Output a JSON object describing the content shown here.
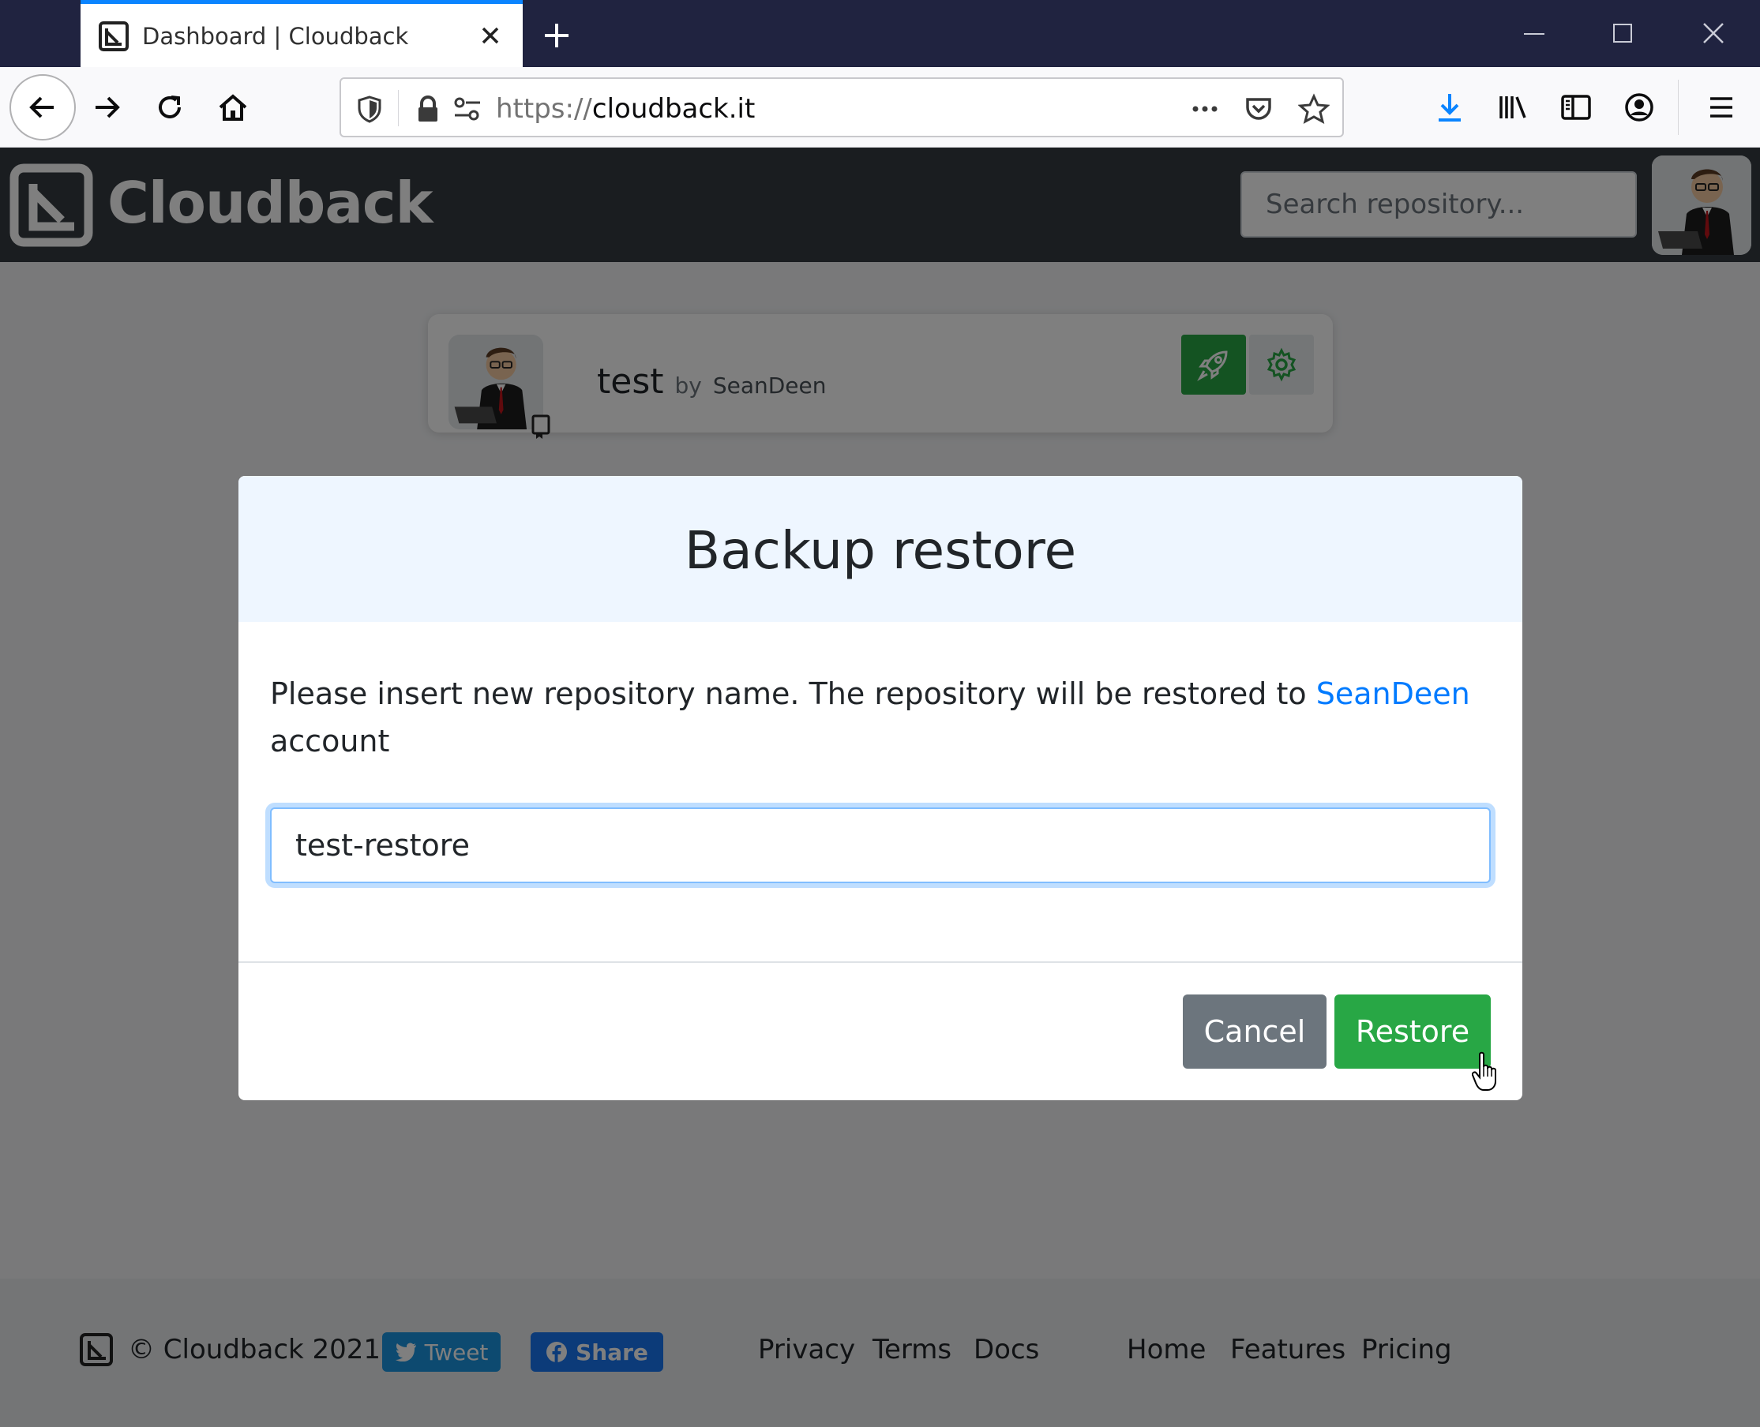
{
  "browser": {
    "tab_title": "Dashboard | Cloudback",
    "url_scheme": "https://",
    "url_host": "cloudback.it"
  },
  "header": {
    "brand": "Cloudback",
    "search_placeholder": "Search repository..."
  },
  "repo": {
    "name": "test",
    "by": "by",
    "owner": "SeanDeen"
  },
  "modal": {
    "title": "Backup restore",
    "text_before": "Please insert new repository name. The repository will be restored to ",
    "account_link": "SeanDeen",
    "text_after": " account",
    "input_value": "test-restore",
    "cancel_label": "Cancel",
    "restore_label": "Restore"
  },
  "footer": {
    "copyright": "© Cloudback 2021",
    "tweet_label": "Tweet",
    "share_label": "Share",
    "links": [
      "Privacy",
      "Terms",
      "Docs",
      "Home",
      "Features",
      "Pricing"
    ]
  },
  "colors": {
    "accent": "#0a84ff",
    "success": "#28a745",
    "secondary": "#6c757d",
    "link": "#007bff",
    "header_bg": "#343a40"
  }
}
